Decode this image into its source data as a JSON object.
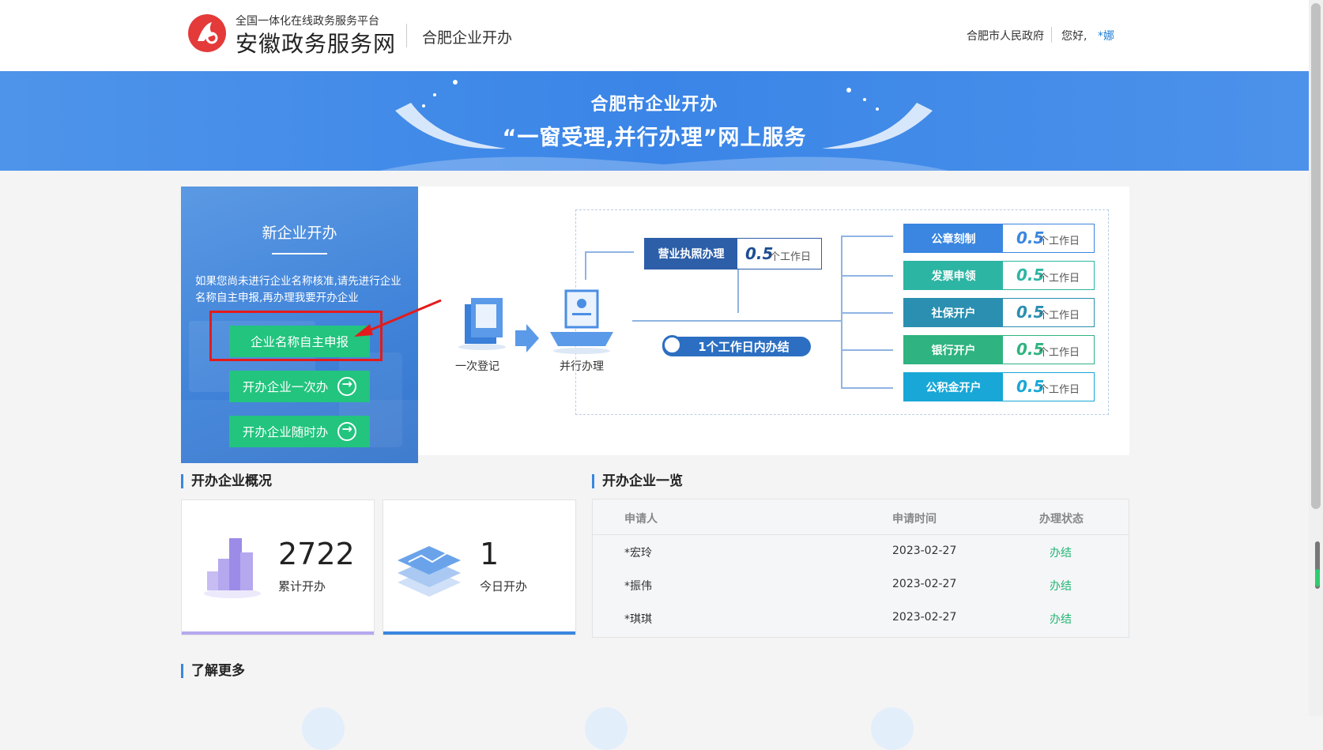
{
  "header": {
    "brand_sub": "全国一体化在线政务服务平台",
    "brand_main": "安徽政务服务网",
    "section": "合肥企业开办",
    "gov_link": "合肥市人民政府",
    "greeting": "您好,",
    "username": "*娜"
  },
  "banner": {
    "title": "合肥市企业开办",
    "subtitle": "“一窗受理,并行办理”网上服务"
  },
  "new_enterprise": {
    "title": "新企业开办",
    "description": "如果您尚未进行企业名称核准,请先进行企业名称自主申报,再办理我要开办企业",
    "buttons": [
      "企业名称自主申报",
      "开办企业一次办",
      "开办企业随时办"
    ]
  },
  "flow": {
    "step1": "一次登记",
    "step2": "并行办理",
    "license_label": "营业执照办理",
    "license_value": "0.5",
    "license_unit": "个工作日",
    "total_label": "1个工作日内办结",
    "services": [
      {
        "label": "公章刻制",
        "value": "0.5",
        "unit": "个工作日",
        "color": "#3a86e0"
      },
      {
        "label": "发票申领",
        "value": "0.5",
        "unit": "个工作日",
        "color": "#2db5a3"
      },
      {
        "label": "社保开户",
        "value": "0.5",
        "unit": "个工作日",
        "color": "#2a8fb0"
      },
      {
        "label": "银行开户",
        "value": "0.5",
        "unit": "个工作日",
        "color": "#2fb380"
      },
      {
        "label": "公积金开户",
        "value": "0.5",
        "unit": "个工作日",
        "color": "#18a7d6"
      }
    ]
  },
  "overview": {
    "title": "开办企业概况",
    "total_value": "2722",
    "total_label": "累计开办",
    "today_value": "1",
    "today_label": "今日开办"
  },
  "list": {
    "title": "开办企业一览",
    "headers": [
      "申请人",
      "申请时间",
      "办理状态"
    ],
    "rows": [
      [
        "*宏玲",
        "2023-02-27",
        "办结"
      ],
      [
        "*振伟",
        "2023-02-27",
        "办结"
      ],
      [
        "*琪琪",
        "2023-02-27",
        "办结"
      ]
    ]
  },
  "more": {
    "title": "了解更多"
  }
}
